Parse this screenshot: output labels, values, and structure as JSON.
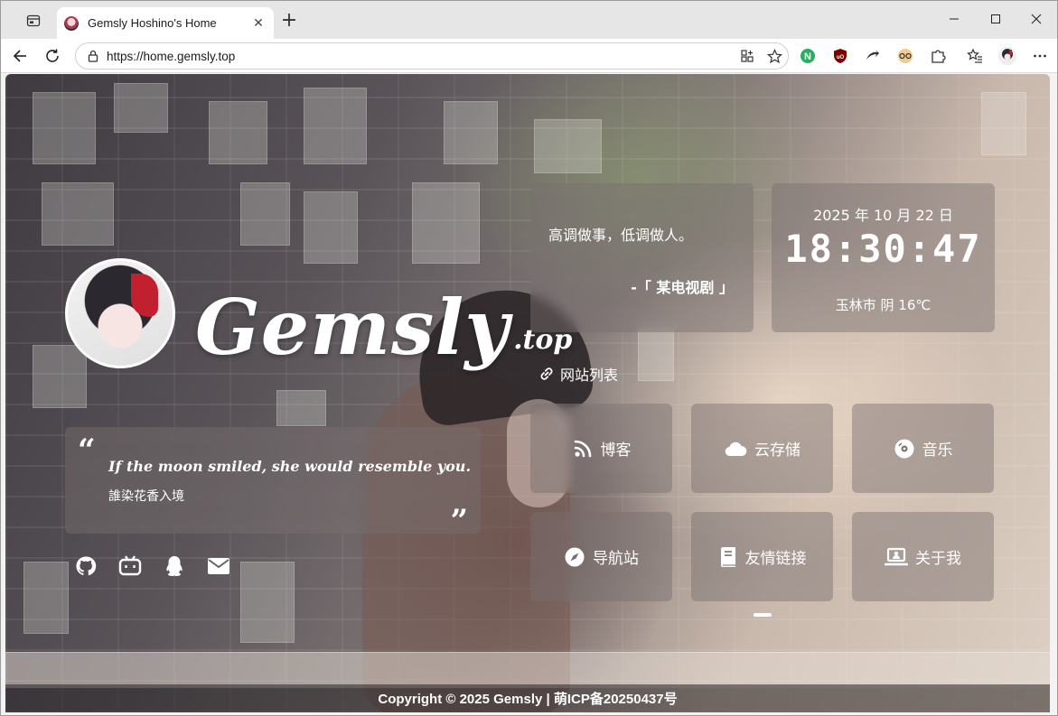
{
  "browser": {
    "tab_title": "Gemsly Hoshino's Home",
    "url": "https://home.gemsly.top",
    "tab_close_glyph": "✕",
    "new_tab_glyph": "+"
  },
  "profile": {
    "logo_main": "Gemsly",
    "logo_sub": ".top"
  },
  "quote": {
    "open_mark": "“",
    "close_mark": "”",
    "english": "If the moon smiled, she would resemble you.",
    "chinese": "誰染花香入境"
  },
  "social_links": [
    {
      "name": "github-icon"
    },
    {
      "name": "bilibili-icon"
    },
    {
      "name": "qq-icon"
    },
    {
      "name": "mail-icon"
    }
  ],
  "hitokoto": {
    "text": "高调做事，低调做人。",
    "from": "-「 某电视剧 」"
  },
  "clock": {
    "date": "2025 年 10 月 22 日",
    "time": "18:30:47",
    "weather": "玉林市 阴 16℃"
  },
  "sites": {
    "label": "网站列表",
    "items": [
      {
        "label": "博客",
        "icon": "blog-icon"
      },
      {
        "label": "云存储",
        "icon": "cloud-icon"
      },
      {
        "label": "音乐",
        "icon": "music-disc-icon"
      },
      {
        "label": "导航站",
        "icon": "compass-icon"
      },
      {
        "label": "友情链接",
        "icon": "book-icon"
      },
      {
        "label": "关于我",
        "icon": "laptop-user-icon"
      }
    ]
  },
  "footer": {
    "text": "Copyright  ©  2025 Gemsly  |  萌ICP备20250437号"
  },
  "colors": {
    "card_glass": "#786e6e",
    "text": "#ffffff",
    "chrome_bg": "#e6e6e6"
  }
}
